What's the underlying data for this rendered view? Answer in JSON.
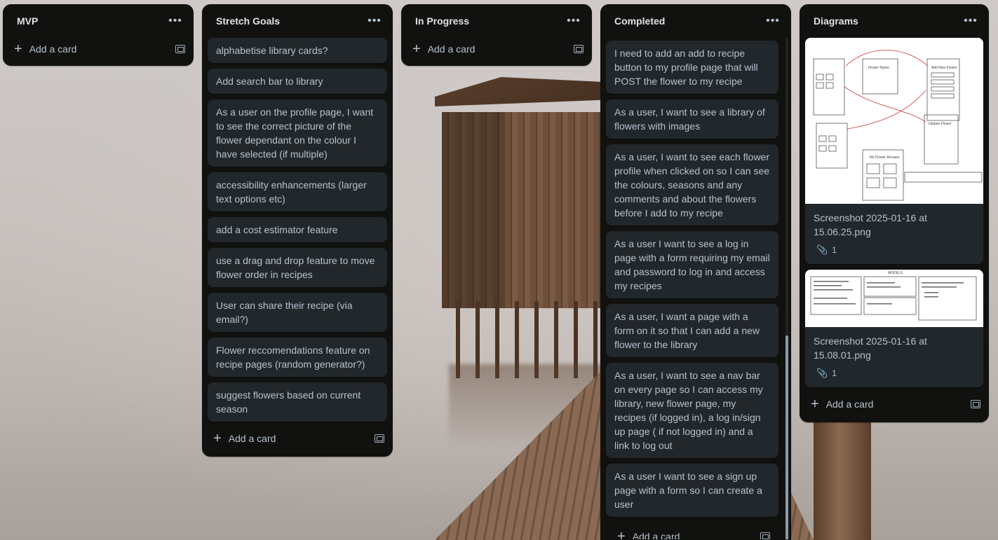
{
  "lists": {
    "mvp": {
      "title": "MVP",
      "add_label": "Add a card"
    },
    "stretch": {
      "title": "Stretch Goals",
      "add_label": "Add a card",
      "cards": [
        "alphabetise library cards?",
        "Add search bar to library",
        "As a user on the profile page, I want to see the correct picture of the flower dependant on the colour I have selected (if multiple)",
        "accessibility enhancements (larger text options etc)",
        "add a cost estimator feature",
        "use a drag and drop feature to move flower order in recipes",
        "User can share their recipe (via email?)",
        "Flower reccomendations feature on recipe pages (random generator?)",
        "suggest flowers based on current season"
      ]
    },
    "progress": {
      "title": "In Progress",
      "add_label": "Add a card"
    },
    "completed": {
      "title": "Completed",
      "add_label": "Add a card",
      "cards": [
        "I need to add an add to recipe button to my profile page that will POST the flower to my recipe",
        "As a user, I want to see a library of flowers with images",
        "As a user, I want to see each flower profile when clicked on so I can see the colours, seasons and any comments and about the flowers before I add to my recipe",
        "As a user I want to see a log in page with a form requiring my email and password to log in and access my recipes",
        "As a user, I want a page with a form on it so that I can add a new flower to the library",
        "As a user, I want to see a nav bar on every page so I can access my library, new flower page, my recipes (if logged in), a log in/sign up page ( if not logged in) and a link to log out",
        "As a user I want to see a sign up page with a form so I can create a user"
      ]
    },
    "diagrams": {
      "title": "Diagrams",
      "add_label": "Add a card",
      "cards": [
        {
          "title": "Screenshot 2025-01-16 at 15.06.25.png",
          "attachments": "1"
        },
        {
          "title": "Screenshot 2025-01-16 at 15.08.01.png",
          "attachments": "1"
        }
      ]
    }
  },
  "icons": {
    "menu": "more-horizontal-icon",
    "add": "plus-icon",
    "template": "card-template-icon",
    "attachment": "paperclip-icon"
  }
}
